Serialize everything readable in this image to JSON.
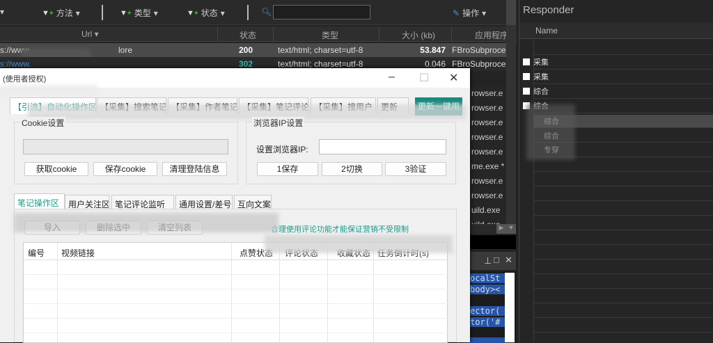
{
  "toolbar": {
    "method": "方法",
    "type": "类型",
    "status": "状态",
    "search_value": "",
    "actions": "操作"
  },
  "columns": {
    "url": "Url",
    "status": "状态",
    "type": "类型",
    "size": "大小 (kb)",
    "app": "应用程序"
  },
  "rows": [
    {
      "url": "s://www",
      "url_tail": "lore",
      "status": "200",
      "type": "text/html; charset=utf-8",
      "size": "53.847",
      "app": "FBroSubproce"
    },
    {
      "url": "s://www.",
      "url_tail": "",
      "status": "302",
      "type": "text/html; charset=utf-8",
      "size": "0.046",
      "app": "FBroSubproce"
    }
  ],
  "processes": [
    "rowser.e",
    "rowser.e",
    "rowser.e",
    "rowser.e",
    "rowser.e",
    "me.exe *",
    "rowser.e",
    "rowser.e",
    "uild.exe",
    "uild.exe"
  ],
  "code_lines": [
    "ocalSt",
    "body><",
    "",
    "ector(",
    "tor('#"
  ],
  "responder": {
    "title": "Responder",
    "name_col": "Name",
    "items": [
      "采集",
      "采集",
      "综合",
      "综合",
      "综合",
      "综合",
      "专穿"
    ]
  },
  "dialog": {
    "title": "(使用者授权)",
    "tabs": [
      "【引流】自动化操作区",
      "【采集】搜索笔记",
      "【采集】作者笔记",
      "【采集】笔记评论",
      "【采集】搜用户",
      "更新"
    ],
    "action_button": "更新一键用",
    "cookie": {
      "label": "Cookie设置",
      "value": "",
      "buttons": [
        "获取cookie",
        "保存cookie",
        "清理登陆信息"
      ]
    },
    "browser": {
      "label": "浏览器IP设置",
      "ip_label": "设置浏览器IP:",
      "ip_value": "",
      "buttons": [
        "1保存",
        "2切换",
        "3验证"
      ]
    },
    "subtabs": [
      "笔记操作区",
      "用户关注区",
      "笔记评论监听",
      "通用设置/差号",
      "互向文案"
    ],
    "panel_buttons": [
      "导入",
      "删除选中",
      "清空列表"
    ],
    "notice": "合理使用评论功能才能保证营销不受限制",
    "table_headers": [
      "编号",
      "视频链接",
      "点赞状态",
      "评论状态",
      "收藏状态",
      "任务倒计时(s)"
    ]
  }
}
